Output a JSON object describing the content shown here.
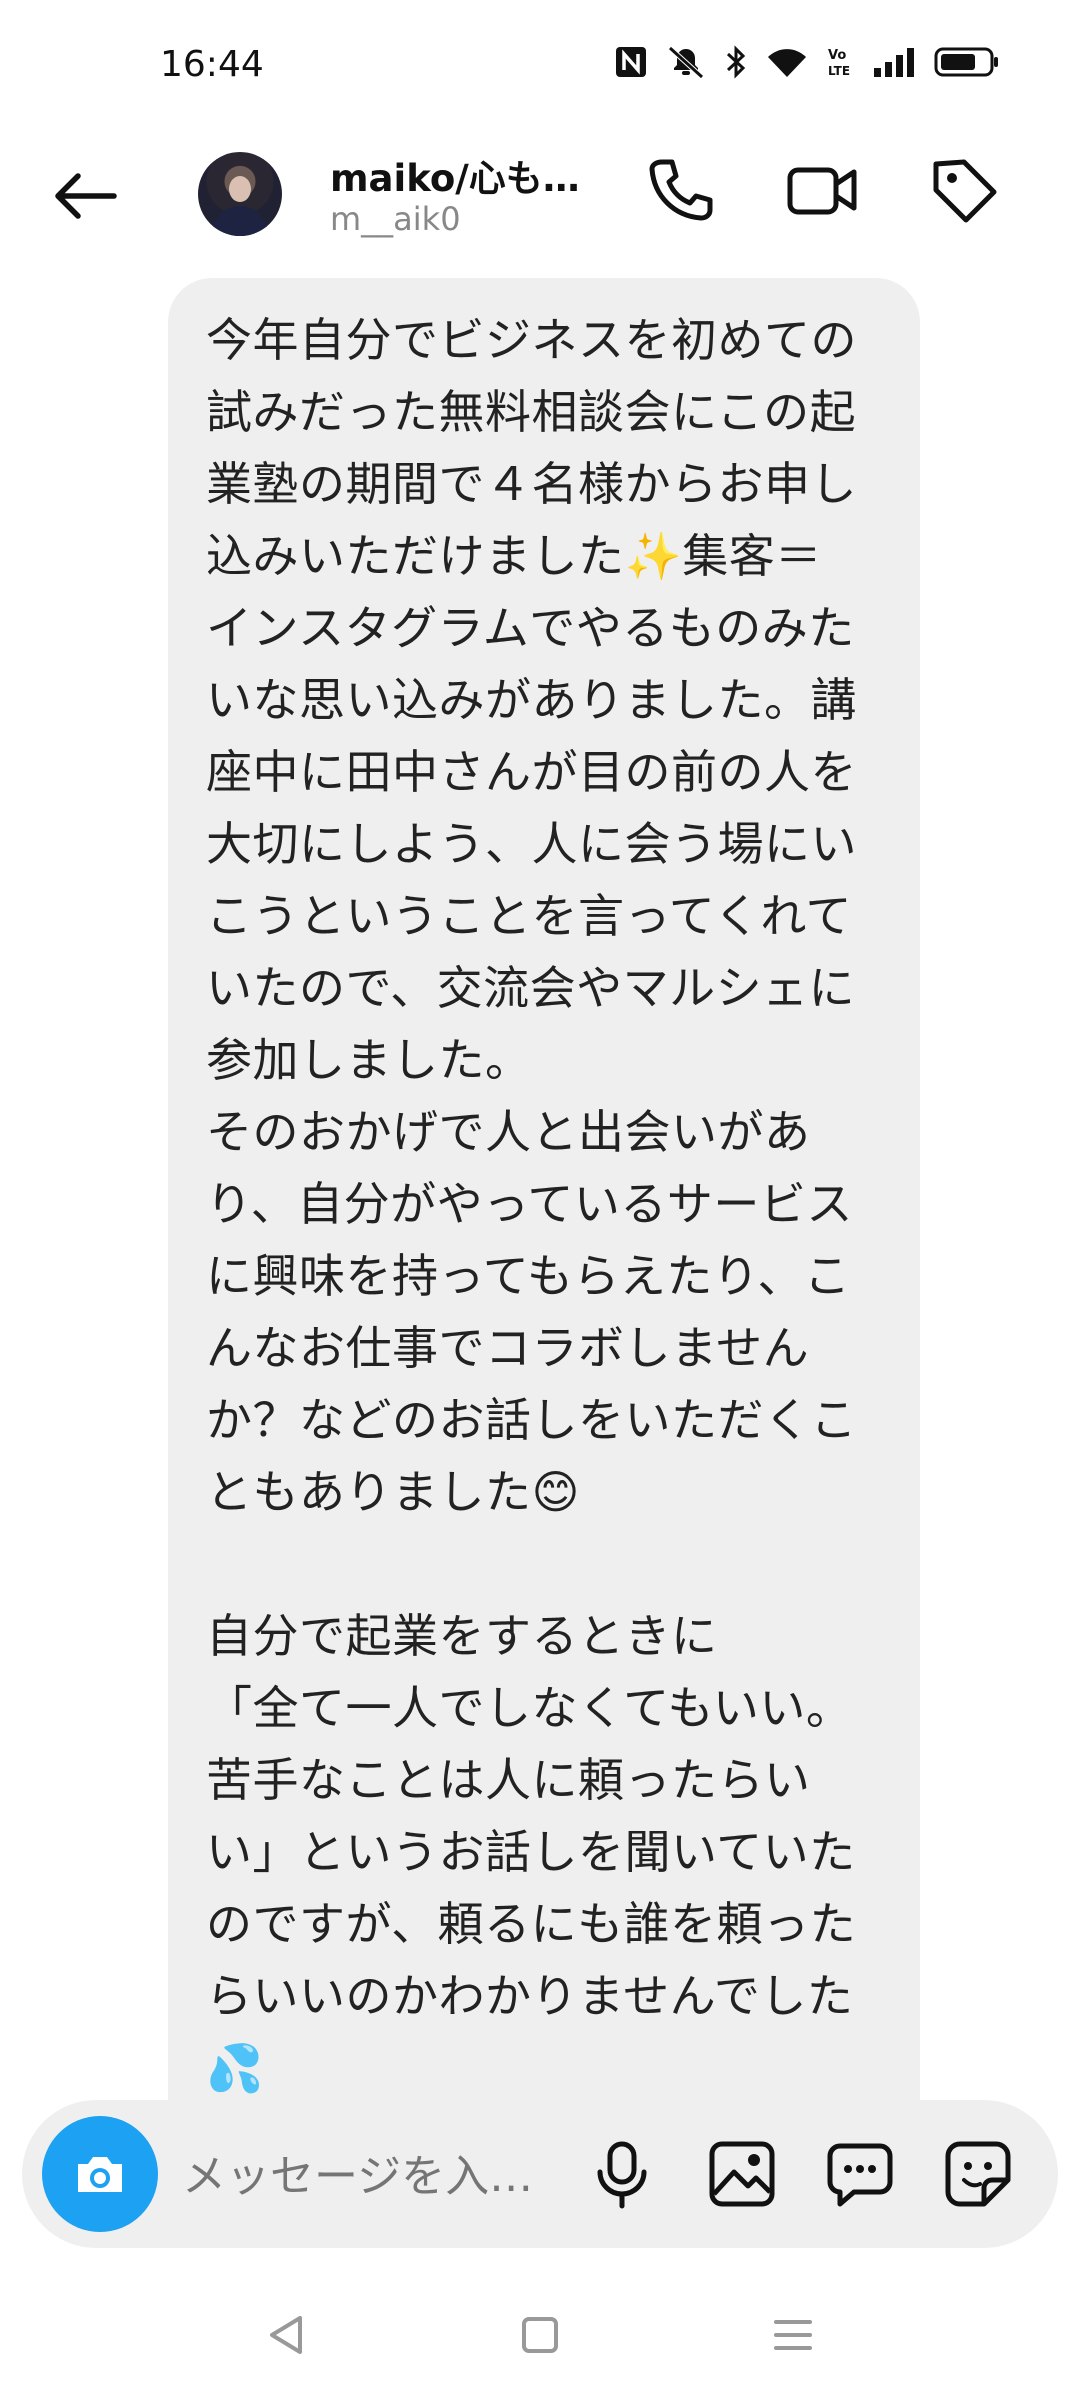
{
  "status_bar": {
    "time": "16:44",
    "icons": [
      "nfc-icon",
      "mute-icon",
      "bluetooth-icon",
      "wifi-icon",
      "volte-icon",
      "signal-icon",
      "battery-icon"
    ]
  },
  "header": {
    "display_name": "maiko/心も…",
    "username": "m__aik0",
    "icons": [
      "back-arrow-icon",
      "phone-icon",
      "video-icon",
      "tag-icon"
    ]
  },
  "message": {
    "text": "今年自分でビジネスを初めての\n試みだった無料相談会にこの起\n業塾の期間で４名様からお申し\n込みいただけました✨️️集客＝\nインスタグラムでやるものみた\nいな思い込みがありました。講\n座中に田中さんが目の前の人を\n大切にしよう、人に会う場にい\nこうということを言ってくれて\nいたので、交流会やマルシェに\n参加しました。\nそのおかげで人と出会いがあ\nり、自分がやっているサービス\nに興味を持ってもらえたり、こ\nんなお仕事でコラボしません\nか？などのお話しをいただくこ\nともありました😊\n\n自分で起業をするときに\n「全て一人でしなくてもいい。\n苦手なことは人に頼ったらい\nい」というお話しを聞いていた\nのですが、頼るにも誰を頼った\nらいいのかわかりませんでした\n💦"
  },
  "composer": {
    "placeholder": "メッセージを入…",
    "icons": [
      "camera-icon",
      "microphone-icon",
      "gallery-icon",
      "chat-icon",
      "sticker-icon"
    ],
    "accent_color": "#1da1f2"
  },
  "nav_bar": {
    "icons": [
      "back-triangle-icon",
      "home-square-icon",
      "menu-lines-icon"
    ]
  }
}
